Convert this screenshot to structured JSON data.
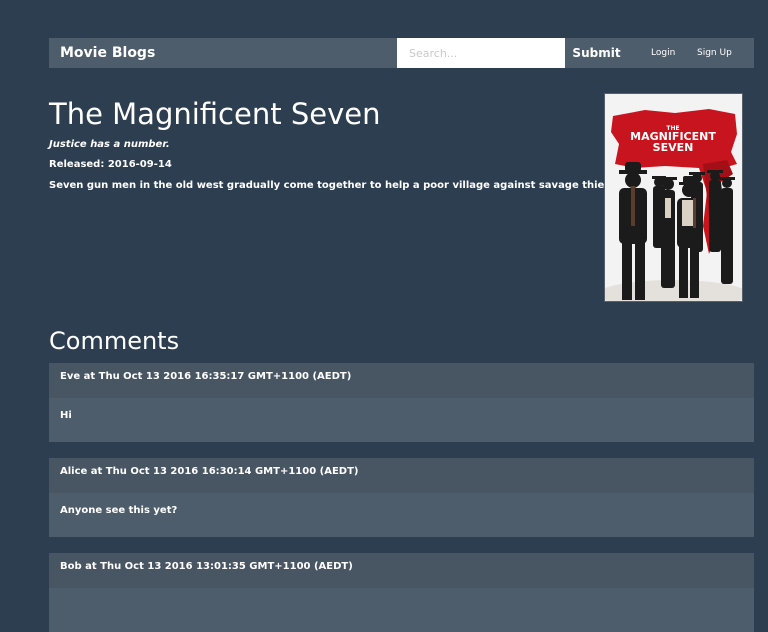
{
  "nav": {
    "brand": "Movie Blogs",
    "search_placeholder": "Search...",
    "submit_label": "Submit",
    "login_label": "Login",
    "signup_label": "Sign Up"
  },
  "movie": {
    "title": "The Magnificent Seven",
    "tagline": "Justice has a number.",
    "released": "Released: 2016-09-14",
    "plot": "Seven gun men in the old west gradually come together to help a poor village against savage thieves.",
    "poster_text_small": "THE",
    "poster_text_line1": "MAGNIFICENT",
    "poster_text_line2": "SEVEN"
  },
  "comments_heading": "Comments",
  "comments": [
    {
      "header": "Eve at Thu Oct 13 2016 16:35:17 GMT+1100 (AEDT)",
      "body": "Hi"
    },
    {
      "header": "Alice at Thu Oct 13 2016 16:30:14 GMT+1100 (AEDT)",
      "body": "Anyone see this yet?"
    },
    {
      "header": "Bob at Thu Oct 13 2016 13:01:35 GMT+1100 (AEDT)",
      "body": ""
    }
  ],
  "colors": {
    "page_bg": "#2c3e50",
    "panel_bg": "#4e5d6c",
    "poster_red": "#c8141e"
  }
}
